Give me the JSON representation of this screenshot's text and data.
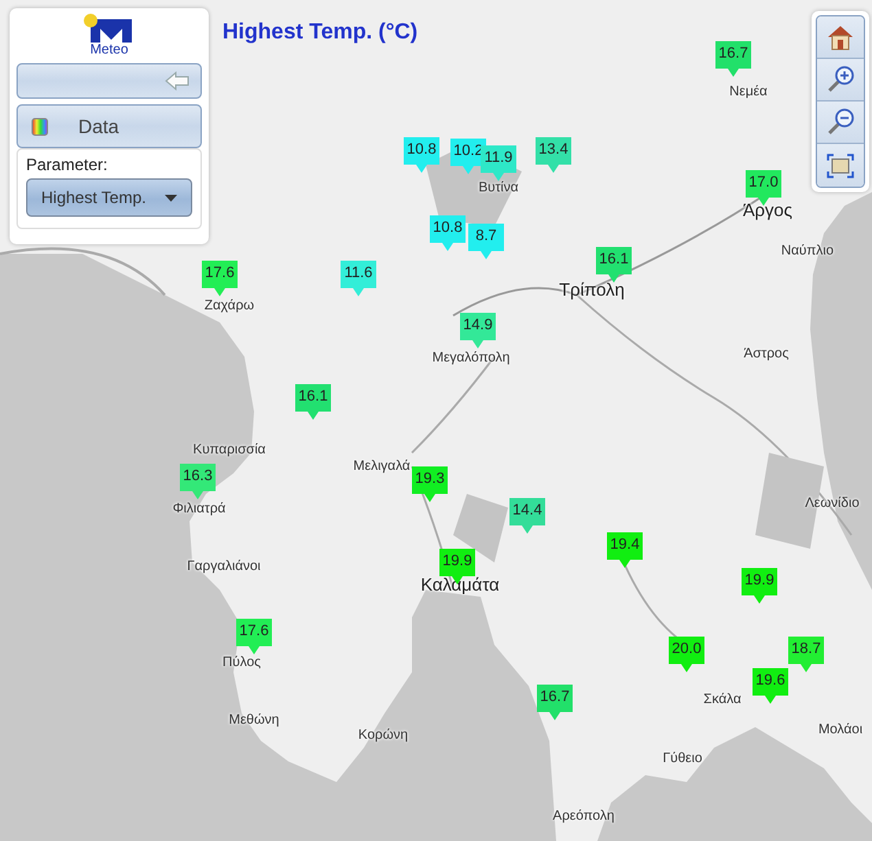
{
  "title": "Highest Temp. (°C)",
  "panel": {
    "logo_text": "Meteo",
    "data_button": "Data",
    "parameter_label": "Parameter:",
    "parameter_select": "Highest Temp."
  },
  "places": [
    {
      "name": "Νεμέα",
      "kind": "town"
    },
    {
      "name": "Βυτίνα",
      "kind": "town"
    },
    {
      "name": "Άργος",
      "kind": "city"
    },
    {
      "name": "Ναύπλιο",
      "kind": "town"
    },
    {
      "name": "Τρίπολη",
      "kind": "city"
    },
    {
      "name": "Ζαχάρω",
      "kind": "town"
    },
    {
      "name": "Μεγαλόπολη",
      "kind": "town"
    },
    {
      "name": "Άστρος",
      "kind": "town"
    },
    {
      "name": "Κυπαρισσία",
      "kind": "town"
    },
    {
      "name": "Μελιγαλά",
      "kind": "town"
    },
    {
      "name": "Φιλιατρά",
      "kind": "town"
    },
    {
      "name": "Λεωνίδιο",
      "kind": "town"
    },
    {
      "name": "Γαργαλιάνοι",
      "kind": "town"
    },
    {
      "name": "Καλαμάτα",
      "kind": "city"
    },
    {
      "name": "Πύλος",
      "kind": "town"
    },
    {
      "name": "Μεθώνη",
      "kind": "town"
    },
    {
      "name": "Κορώνη",
      "kind": "town"
    },
    {
      "name": "Σκάλα",
      "kind": "town"
    },
    {
      "name": "Μολάοι",
      "kind": "town"
    },
    {
      "name": "Γύθειο",
      "kind": "town"
    },
    {
      "name": "Αρεόπολη",
      "kind": "town"
    }
  ],
  "stations": [
    {
      "value": "16.7",
      "color": "#22e06a"
    },
    {
      "value": "10.8",
      "color": "#22eeee"
    },
    {
      "value": "10.2",
      "color": "#22eeee"
    },
    {
      "value": "11.9",
      "color": "#2ee8c8"
    },
    {
      "value": "13.4",
      "color": "#33e0a8"
    },
    {
      "value": "17.0",
      "color": "#22e85e"
    },
    {
      "value": "10.8",
      "color": "#22eeee"
    },
    {
      "value": "8.7",
      "color": "#22eeee"
    },
    {
      "value": "16.1",
      "color": "#22e070"
    },
    {
      "value": "17.6",
      "color": "#22ee55"
    },
    {
      "value": "11.6",
      "color": "#33eed8"
    },
    {
      "value": "14.9",
      "color": "#33e898"
    },
    {
      "value": "16.1",
      "color": "#22e070"
    },
    {
      "value": "16.3",
      "color": "#33e878"
    },
    {
      "value": "19.3",
      "color": "#11ee22"
    },
    {
      "value": "14.4",
      "color": "#33dd99"
    },
    {
      "value": "19.4",
      "color": "#11ee11"
    },
    {
      "value": "19.9",
      "color": "#11ee11"
    },
    {
      "value": "19.9",
      "color": "#11ee11"
    },
    {
      "value": "17.6",
      "color": "#22ee55"
    },
    {
      "value": "20.0",
      "color": "#11ee11"
    },
    {
      "value": "18.7",
      "color": "#22ee33"
    },
    {
      "value": "19.6",
      "color": "#11ee11"
    },
    {
      "value": "16.7",
      "color": "#22e06a"
    }
  ]
}
